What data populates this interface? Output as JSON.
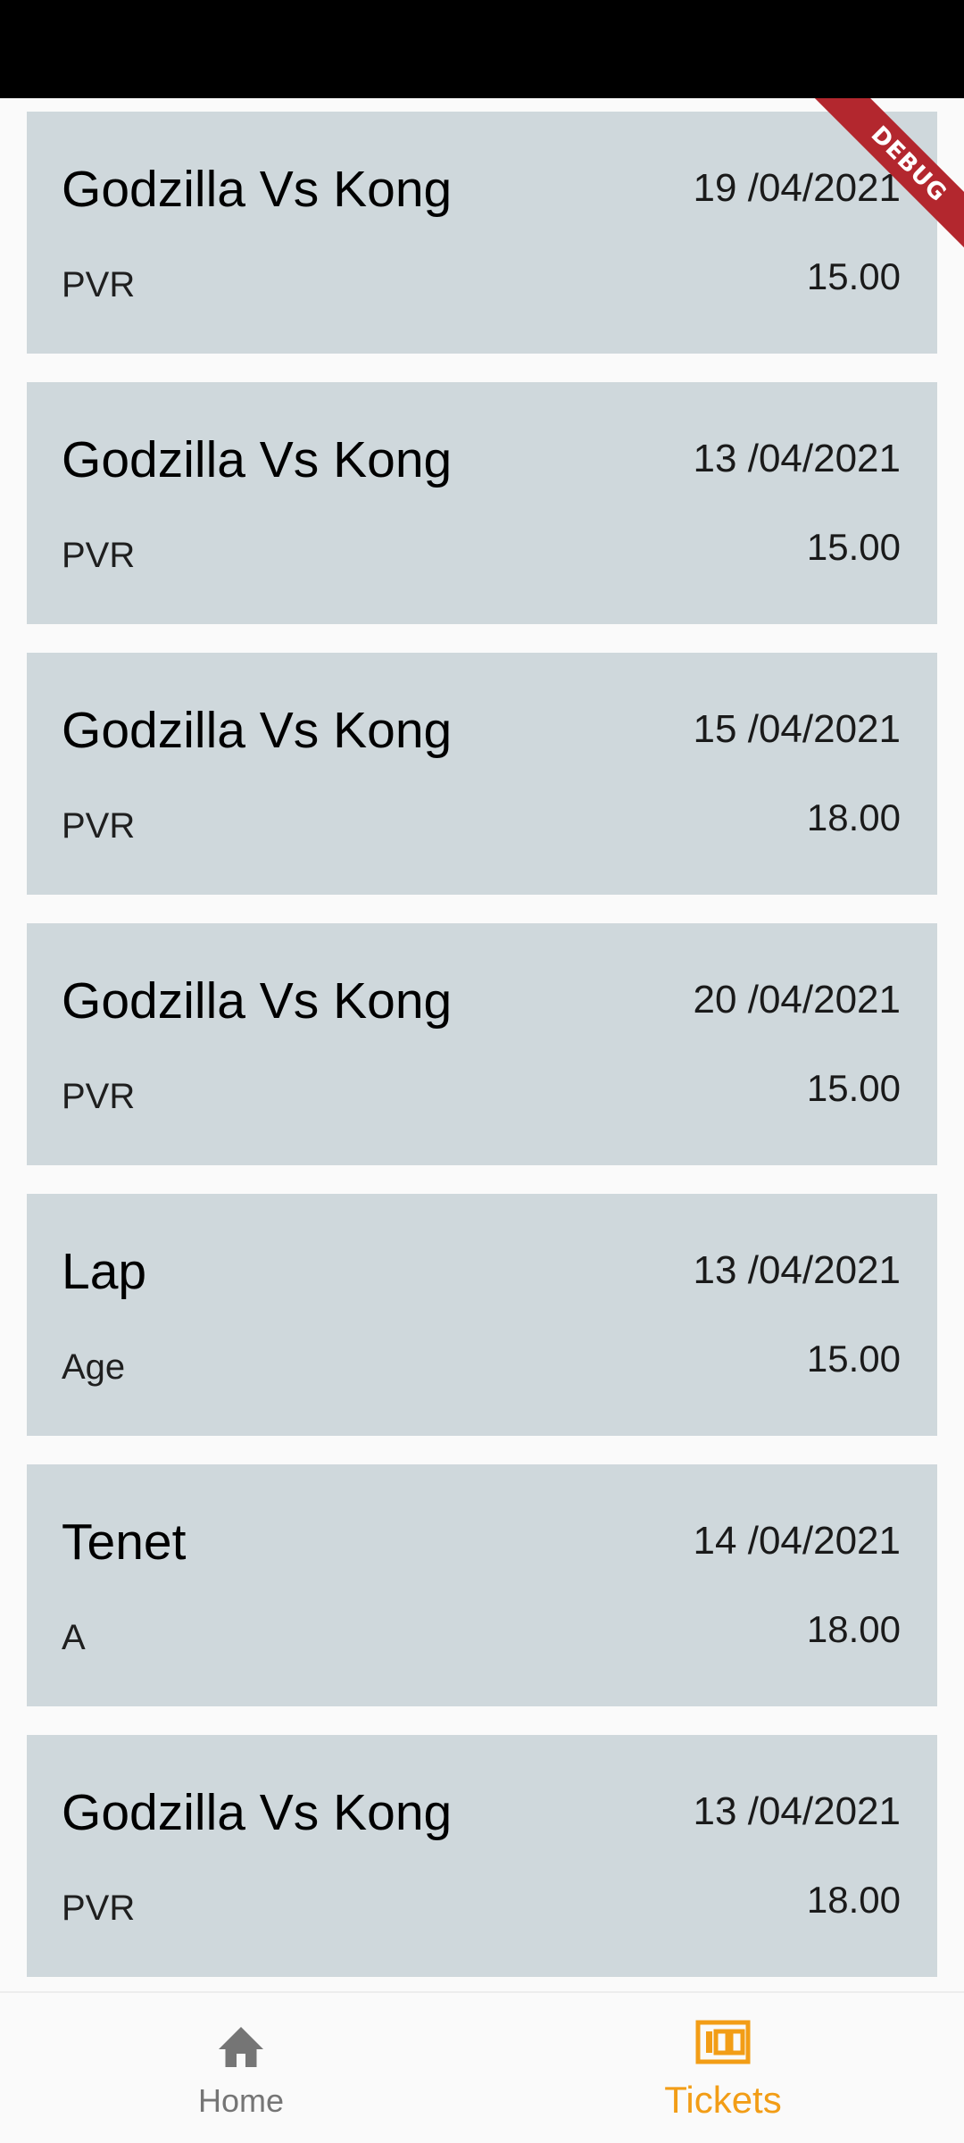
{
  "banner": {
    "label": "DEBUG"
  },
  "tickets": [
    {
      "title": "Godzilla Vs Kong",
      "date": "19 /04/2021",
      "venue": "PVR",
      "price": "15.00"
    },
    {
      "title": "Godzilla Vs Kong",
      "date": "13 /04/2021",
      "venue": "PVR",
      "price": "15.00"
    },
    {
      "title": "Godzilla Vs Kong",
      "date": "15 /04/2021",
      "venue": "PVR",
      "price": "18.00"
    },
    {
      "title": "Godzilla Vs Kong",
      "date": "20 /04/2021",
      "venue": "PVR",
      "price": "15.00"
    },
    {
      "title": "Lap",
      "date": "13 /04/2021",
      "venue": "Age",
      "price": "15.00"
    },
    {
      "title": "Tenet",
      "date": "14 /04/2021",
      "venue": "A",
      "price": "18.00"
    },
    {
      "title": "Godzilla Vs Kong",
      "date": "13 /04/2021",
      "venue": "PVR",
      "price": "18.00"
    }
  ],
  "bottom_nav": {
    "items": [
      {
        "label": "Home",
        "icon": "home-icon",
        "selected": false
      },
      {
        "label": "Tickets",
        "icon": "tickets-icon",
        "selected": true
      }
    ]
  },
  "colors": {
    "card_background": "#cfd8dc",
    "accent": "#f29d16",
    "inactive": "#757575",
    "debug_banner": "#b3272e"
  }
}
